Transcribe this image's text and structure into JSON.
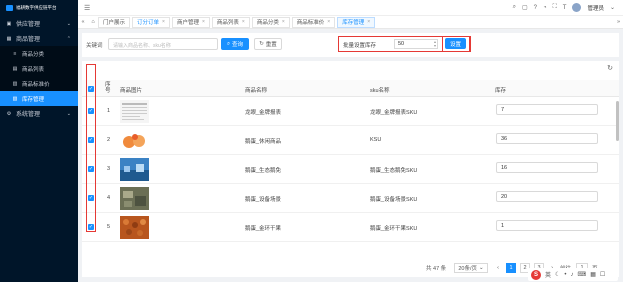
{
  "app": {
    "logo_text": "福耕数字供应链平台"
  },
  "sidebar": {
    "items": [
      {
        "label": "供应管理",
        "icon": "truck-icon"
      },
      {
        "label": "商品管理",
        "icon": "box-icon"
      },
      {
        "label": "商品分类",
        "icon": "tree-icon"
      },
      {
        "label": "商品列表",
        "icon": "list-icon"
      },
      {
        "label": "商品标准价",
        "icon": "tag-icon"
      },
      {
        "label": "库存管理",
        "icon": "warehouse-icon"
      },
      {
        "label": "系统管理",
        "icon": "gear-icon"
      }
    ]
  },
  "header": {
    "user": "管理员",
    "collapse_icon": "menu-fold-icon"
  },
  "tabs": [
    {
      "label": "门户展示",
      "closable": false
    },
    {
      "label": "订分订单",
      "closable": true
    },
    {
      "label": "商户管理",
      "closable": true
    },
    {
      "label": "商品列表",
      "closable": true
    },
    {
      "label": "商品分类",
      "closable": true
    },
    {
      "label": "商品标准价",
      "closable": true
    },
    {
      "label": "库存管理",
      "closable": true
    }
  ],
  "search": {
    "keyword_label": "关键词",
    "keyword_placeholder": "请输入商品名称、sku名称",
    "search_btn": "查询",
    "reset_btn": "重置",
    "bulk_label": "批量设置库存",
    "bulk_value": "50",
    "set_btn": "设置"
  },
  "table": {
    "headers": [
      "序号",
      "商品图片",
      "商品名称",
      "sku名称",
      "库存"
    ],
    "rows": [
      {
        "no": "1",
        "name": "龙眼_金牌报表",
        "sku": "龙眼_金牌报表SKU",
        "stock": "7"
      },
      {
        "no": "2",
        "name": "鹅蛋_休闲商品",
        "sku": "KSU",
        "stock": "36"
      },
      {
        "no": "3",
        "name": "鹅蛋_生态鹅免",
        "sku": "鹅蛋_生态鹅免SKU",
        "stock": "16"
      },
      {
        "no": "4",
        "name": "鹅蛋_设备场景",
        "sku": "鹅蛋_设备场景SKU",
        "stock": "20"
      },
      {
        "no": "5",
        "name": "鹅蛋_金环干果",
        "sku": "鹅蛋_金环干果SKU",
        "stock": "1"
      }
    ]
  },
  "pager": {
    "total": "共 47 条",
    "page_size": "20条/页",
    "pages": [
      "1",
      "2",
      "3"
    ],
    "current": "1",
    "goto_label": "前往",
    "goto_value": "1",
    "page_unit": "页"
  },
  "colors": {
    "primary": "#1890ff",
    "highlight": "#e53935",
    "sidebar": "#001529"
  }
}
